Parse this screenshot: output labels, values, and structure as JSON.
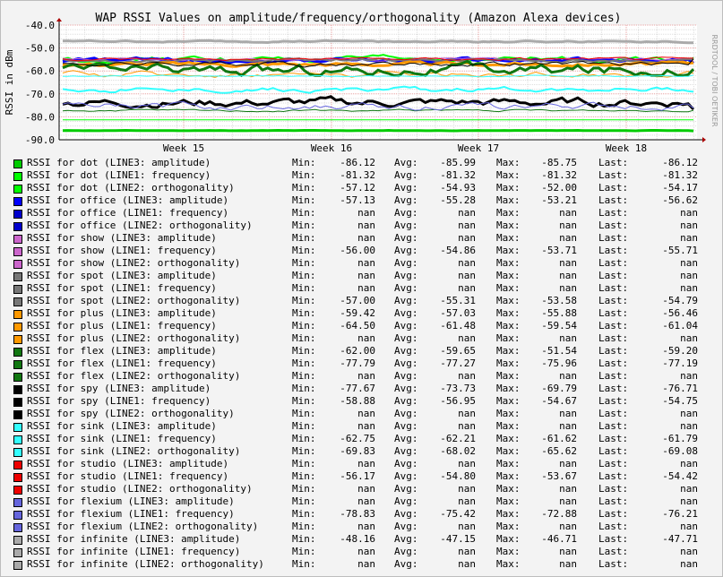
{
  "chart_data": {
    "type": "line",
    "title": "WAP RSSI Values on amplitude/frequency/orthogonality (Amazon Alexa devices)",
    "ylabel": "RSSI in dBm",
    "watermark": "RRDTOOL / TOBI OETIKER",
    "ylim": [
      -90,
      -40
    ],
    "yticks": [
      "-40.0",
      "-50.0",
      "-60.0",
      "-70.0",
      "-80.0",
      "-90.0"
    ],
    "x_ticks": [
      "Week 15",
      "Week 16",
      "Week 17",
      "Week 18"
    ],
    "grid": true,
    "legend_position": "bottom",
    "stat_labels": {
      "min": "Min:",
      "avg": "Avg:",
      "max": "Max:",
      "last": "Last:"
    },
    "series": [
      {
        "name": "RSSI for dot (LINE3: amplitude)",
        "color": "#00cc00",
        "min": "-86.12",
        "avg": "-85.99",
        "max": "-85.75",
        "last": "-86.12"
      },
      {
        "name": "RSSI for dot (LINE1: frequency)",
        "color": "#00ff00",
        "min": "-81.32",
        "avg": "-81.32",
        "max": "-81.32",
        "last": "-81.32"
      },
      {
        "name": "RSSI for dot (LINE2: orthogonality)",
        "color": "#00ff00",
        "min": "-57.12",
        "avg": "-54.93",
        "max": "-52.00",
        "last": "-54.17"
      },
      {
        "name": "RSSI for office (LINE3: amplitude)",
        "color": "#0000ff",
        "min": "-57.13",
        "avg": "-55.28",
        "max": "-53.21",
        "last": "-56.62"
      },
      {
        "name": "RSSI for office (LINE1: frequency)",
        "color": "#0000cc",
        "min": "nan",
        "avg": "nan",
        "max": "nan",
        "last": "nan"
      },
      {
        "name": "RSSI for office (LINE2: orthogonality)",
        "color": "#0000cc",
        "min": "nan",
        "avg": "nan",
        "max": "nan",
        "last": "nan"
      },
      {
        "name": "RSSI for show (LINE3: amplitude)",
        "color": "#cc66cc",
        "min": "nan",
        "avg": "nan",
        "max": "nan",
        "last": "nan"
      },
      {
        "name": "RSSI for show (LINE1: frequency)",
        "color": "#cc66cc",
        "min": "-56.00",
        "avg": "-54.86",
        "max": "-53.71",
        "last": "-55.71"
      },
      {
        "name": "RSSI for show (LINE2: orthogonality)",
        "color": "#cc66cc",
        "min": "nan",
        "avg": "nan",
        "max": "nan",
        "last": "nan"
      },
      {
        "name": "RSSI for spot (LINE3: amplitude)",
        "color": "#777777",
        "min": "nan",
        "avg": "nan",
        "max": "nan",
        "last": "nan"
      },
      {
        "name": "RSSI for spot (LINE1: frequency)",
        "color": "#777777",
        "min": "nan",
        "avg": "nan",
        "max": "nan",
        "last": "nan"
      },
      {
        "name": "RSSI for spot (LINE2: orthogonality)",
        "color": "#777777",
        "min": "-57.00",
        "avg": "-55.31",
        "max": "-53.58",
        "last": "-54.79"
      },
      {
        "name": "RSSI for plus (LINE3: amplitude)",
        "color": "#ff9900",
        "min": "-59.42",
        "avg": "-57.03",
        "max": "-55.88",
        "last": "-56.46"
      },
      {
        "name": "RSSI for plus (LINE1: frequency)",
        "color": "#ff9900",
        "min": "-64.50",
        "avg": "-61.48",
        "max": "-59.54",
        "last": "-61.04"
      },
      {
        "name": "RSSI for plus (LINE2: orthogonality)",
        "color": "#ff9900",
        "min": "nan",
        "avg": "nan",
        "max": "nan",
        "last": "nan"
      },
      {
        "name": "RSSI for flex (LINE3: amplitude)",
        "color": "#117711",
        "min": "-62.00",
        "avg": "-59.65",
        "max": "-51.54",
        "last": "-59.20"
      },
      {
        "name": "RSSI for flex (LINE1: frequency)",
        "color": "#117711",
        "min": "-77.79",
        "avg": "-77.27",
        "max": "-75.96",
        "last": "-77.19"
      },
      {
        "name": "RSSI for flex (LINE2: orthogonality)",
        "color": "#117711",
        "min": "nan",
        "avg": "nan",
        "max": "nan",
        "last": "nan"
      },
      {
        "name": "RSSI for spy (LINE3: amplitude)",
        "color": "#000000",
        "min": "-77.67",
        "avg": "-73.73",
        "max": "-69.79",
        "last": "-76.71"
      },
      {
        "name": "RSSI for spy (LINE1: frequency)",
        "color": "#000000",
        "min": "-58.88",
        "avg": "-56.95",
        "max": "-54.67",
        "last": "-54.75"
      },
      {
        "name": "RSSI for spy (LINE2: orthogonality)",
        "color": "#000000",
        "min": "nan",
        "avg": "nan",
        "max": "nan",
        "last": "nan"
      },
      {
        "name": "RSSI for sink (LINE3: amplitude)",
        "color": "#33ffff",
        "min": "nan",
        "avg": "nan",
        "max": "nan",
        "last": "nan"
      },
      {
        "name": "RSSI for sink (LINE1: frequency)",
        "color": "#33ffff",
        "min": "-62.75",
        "avg": "-62.21",
        "max": "-61.62",
        "last": "-61.79"
      },
      {
        "name": "RSSI for sink (LINE2: orthogonality)",
        "color": "#33ffff",
        "min": "-69.83",
        "avg": "-68.02",
        "max": "-65.62",
        "last": "-69.08"
      },
      {
        "name": "RSSI for studio (LINE3: amplitude)",
        "color": "#ee0000",
        "min": "nan",
        "avg": "nan",
        "max": "nan",
        "last": "nan"
      },
      {
        "name": "RSSI for studio (LINE1: frequency)",
        "color": "#ee0000",
        "min": "-56.17",
        "avg": "-54.80",
        "max": "-53.67",
        "last": "-54.42"
      },
      {
        "name": "RSSI for studio (LINE2: orthogonality)",
        "color": "#ee0000",
        "min": "nan",
        "avg": "nan",
        "max": "nan",
        "last": "nan"
      },
      {
        "name": "RSSI for flexium (LINE3: amplitude)",
        "color": "#6666dd",
        "min": "nan",
        "avg": "nan",
        "max": "nan",
        "last": "nan"
      },
      {
        "name": "RSSI for flexium (LINE1: frequency)",
        "color": "#6666dd",
        "min": "-78.83",
        "avg": "-75.42",
        "max": "-72.88",
        "last": "-76.21"
      },
      {
        "name": "RSSI for flexium (LINE2: orthogonality)",
        "color": "#6666dd",
        "min": "nan",
        "avg": "nan",
        "max": "nan",
        "last": "nan"
      },
      {
        "name": "RSSI for infinite (LINE3: amplitude)",
        "color": "#aaaaaa",
        "min": "-48.16",
        "avg": "-47.15",
        "max": "-46.71",
        "last": "-47.71"
      },
      {
        "name": "RSSI for infinite (LINE1: frequency)",
        "color": "#aaaaaa",
        "min": "nan",
        "avg": "nan",
        "max": "nan",
        "last": "nan"
      },
      {
        "name": "RSSI for infinite (LINE2: orthogonality)",
        "color": "#aaaaaa",
        "min": "nan",
        "avg": "nan",
        "max": "nan",
        "last": "nan"
      }
    ]
  }
}
